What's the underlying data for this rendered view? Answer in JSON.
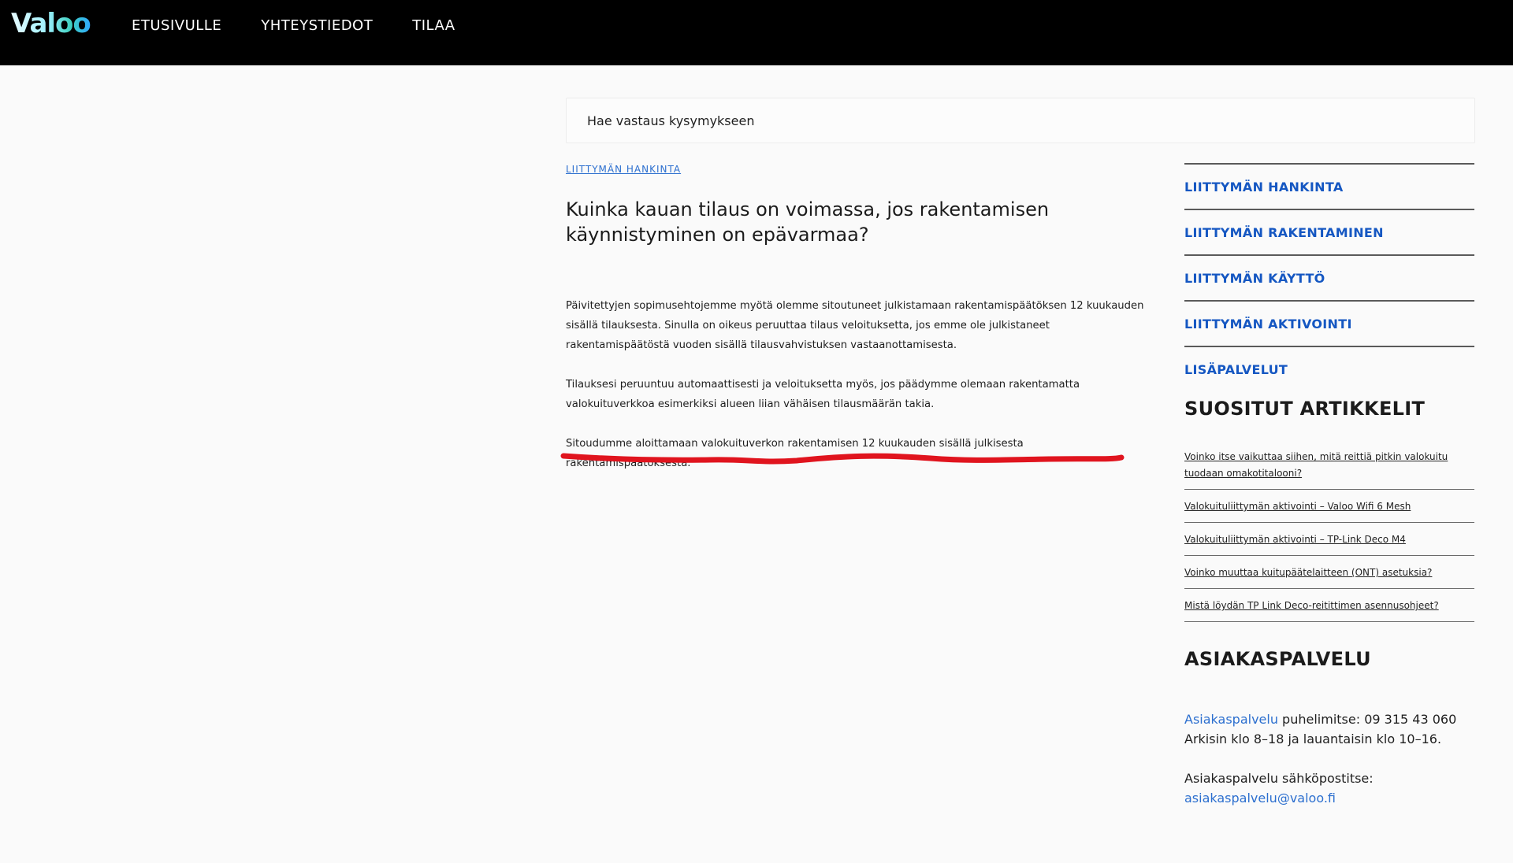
{
  "logo": {
    "text": "Valoo"
  },
  "nav": [
    {
      "label": "ETUSIVULLE"
    },
    {
      "label": "YHTEYSTIEDOT"
    },
    {
      "label": "TILAA"
    }
  ],
  "search": {
    "placeholder": "Hae vastaus kysymykseen"
  },
  "breadcrumb": "LIITTYMÄN HANKINTA",
  "article": {
    "title": "Kuinka kauan tilaus on voimassa, jos rakentamisen käynnistyminen on epävarmaa?",
    "paragraphs": [
      "Päivitettyjen sopimusehtojemme myötä olemme sitoutuneet julkistamaan rakentamispäätöksen 12 kuukauden sisällä tilauksesta. Sinulla on oikeus peruuttaa tilaus veloituksetta, jos emme ole julkistaneet rakentamispäätöstä vuoden sisällä tilausvahvistuksen vastaanottamisesta.",
      "Tilauksesi peruuntuu automaattisesti ja veloituksetta myös, jos päädymme olemaan rakentamatta valokuituverkkoa esimerkiksi alueen liian vähäisen tilausmäärän takia.",
      "Sitoudumme aloittamaan valokuituverkon rakentamisen 12 kuukauden sisällä julkisesta rakentamispäätöksestä."
    ],
    "annotation_color": "#e0141e"
  },
  "sidebar": {
    "categories": [
      {
        "label": "LIITTYMÄN HANKINTA"
      },
      {
        "label": "LIITTYMÄN RAKENTAMINEN"
      },
      {
        "label": "LIITTYMÄN KÄYTTÖ"
      },
      {
        "label": "LIITTYMÄN AKTIVOINTI"
      },
      {
        "label": "LISÄPALVELUT"
      }
    ],
    "popular_title": "SUOSITUT ARTIKKELIT",
    "popular": [
      {
        "label": "Voinko itse vaikuttaa siihen, mitä reittiä pitkin valokuitu tuodaan omakotitalooni?"
      },
      {
        "label": "Valokuituliittymän aktivointi – Valoo Wifi 6 Mesh"
      },
      {
        "label": "Valokuituliittymän aktivointi – TP-Link Deco M4"
      },
      {
        "label": "Voinko muuttaa kuitupäätelaitteen (ONT) asetuksia?"
      },
      {
        "label": "Mistä löydän TP Link Deco-reitittimen asennusohjeet?"
      }
    ],
    "customer_service": {
      "title": "ASIAKASPALVELU",
      "phone_link": "Asiakaspalvelu",
      "phone_label": " puhelimitse: ",
      "phone_number": "09 315 43 060",
      "hours": "Arkisin klo 8–18 ja lauantaisin klo 10–16.",
      "email_label": "Asiakaspalvelu sähköpostitse:",
      "email": "asiakaspalvelu@valoo.fi"
    }
  },
  "colors": {
    "link": "#1557c2",
    "header_bg": "#000000",
    "page_bg": "#fafafa"
  }
}
